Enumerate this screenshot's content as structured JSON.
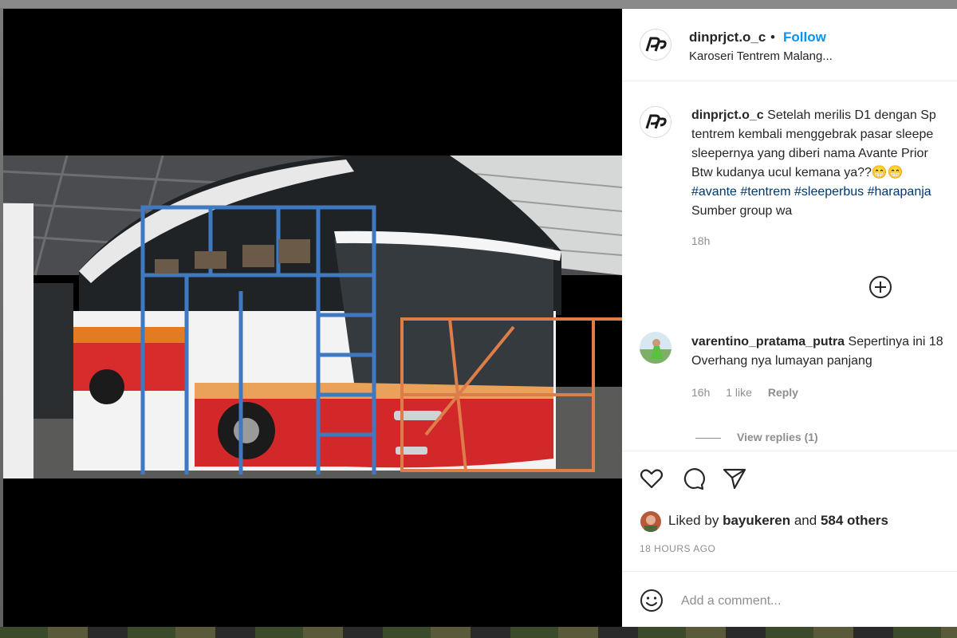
{
  "post": {
    "author": "dinprjct.o_c",
    "separator": "•",
    "follow_label": "Follow",
    "location": "Karoseri Tentrem Malang..."
  },
  "caption": {
    "username": "dinprjct.o_c",
    "line1": "Setelah merilis D1 dengan Sp",
    "line2": "tentrem kembali menggebrak pasar sleepe",
    "line3": "sleepernya yang diberi nama Avante Prior",
    "line4": "Btw kudanya ucul kemana ya??😁😁",
    "hashtags": [
      "#avante",
      "#tentrem",
      "#sleeperbus",
      "#harapanja"
    ],
    "line6": "Sumber group wa",
    "time": "18h"
  },
  "comment": {
    "username": "varentino_pratama_putra",
    "line1": "Sepertinya ini 18",
    "line2": "Overhang nya lumayan panjang",
    "time": "16h",
    "likes": "1 like",
    "reply_label": "Reply",
    "view_replies": "View replies (1)"
  },
  "likes": {
    "prefix": "Liked by",
    "user": "bayukeren",
    "middle": "and",
    "others": "584 others"
  },
  "timeago": "18 HOURS AGO",
  "add_comment": {
    "placeholder": "Add a comment..."
  },
  "icons": {
    "more": "add-circle-icon",
    "like": "heart-icon",
    "comment": "comment-icon",
    "share": "share-icon",
    "emoji": "emoji-icon"
  },
  "colors": {
    "follow": "#0095f6",
    "hashtag": "#00376b",
    "muted": "#8e8e8e",
    "text": "#262626"
  }
}
